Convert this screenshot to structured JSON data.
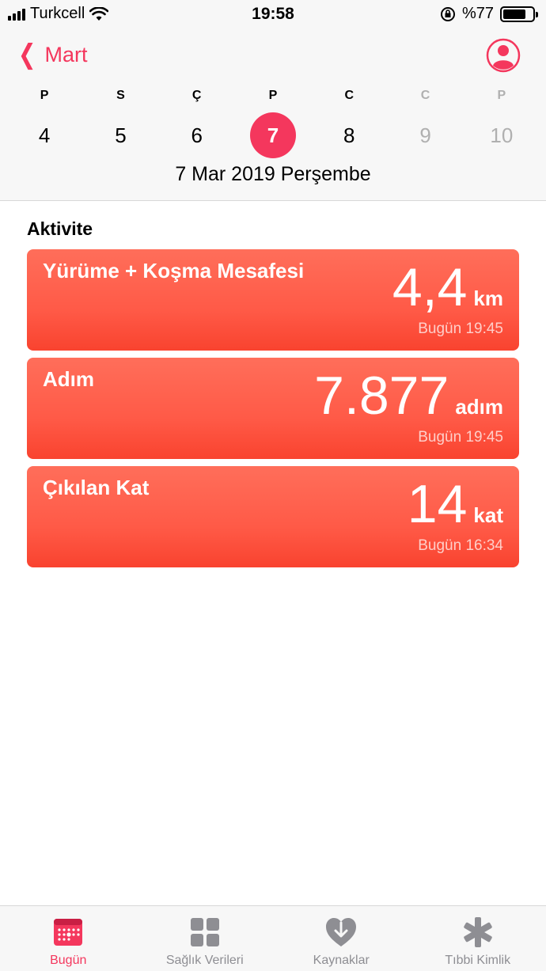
{
  "status_bar": {
    "carrier": "Turkcell",
    "time": "19:58",
    "battery_text": "%77",
    "battery_level": 0.77
  },
  "header": {
    "back_label": "Mart",
    "weekdays": [
      "P",
      "S",
      "Ç",
      "P",
      "C",
      "C",
      "P"
    ],
    "dates": [
      "4",
      "5",
      "6",
      "7",
      "8",
      "9",
      "10"
    ],
    "selected_date": "7",
    "full_date": "7 Mar 2019 Perşembe"
  },
  "section": {
    "title": "Aktivite"
  },
  "cards": [
    {
      "title": "Yürüme + Koşma Mesafesi",
      "value": "4,4",
      "unit": "km",
      "time": "Bugün 19:45"
    },
    {
      "title": "Adım",
      "value": "7.877",
      "unit": "adım",
      "time": "Bugün 19:45"
    },
    {
      "title": "Çıkılan Kat",
      "value": "14",
      "unit": "kat",
      "time": "Bugün 16:34"
    }
  ],
  "tabs": [
    {
      "label": "Bugün",
      "icon": "calendar-icon",
      "active": true
    },
    {
      "label": "Sağlık Verileri",
      "icon": "grid-icon",
      "active": false
    },
    {
      "label": "Kaynaklar",
      "icon": "heart-download-icon",
      "active": false
    },
    {
      "label": "Tıbbi Kimlik",
      "icon": "asterisk-icon",
      "active": false
    }
  ],
  "colors": {
    "accent": "#f4375d",
    "card": "#ff5a47",
    "inactive": "#8e8e93"
  }
}
